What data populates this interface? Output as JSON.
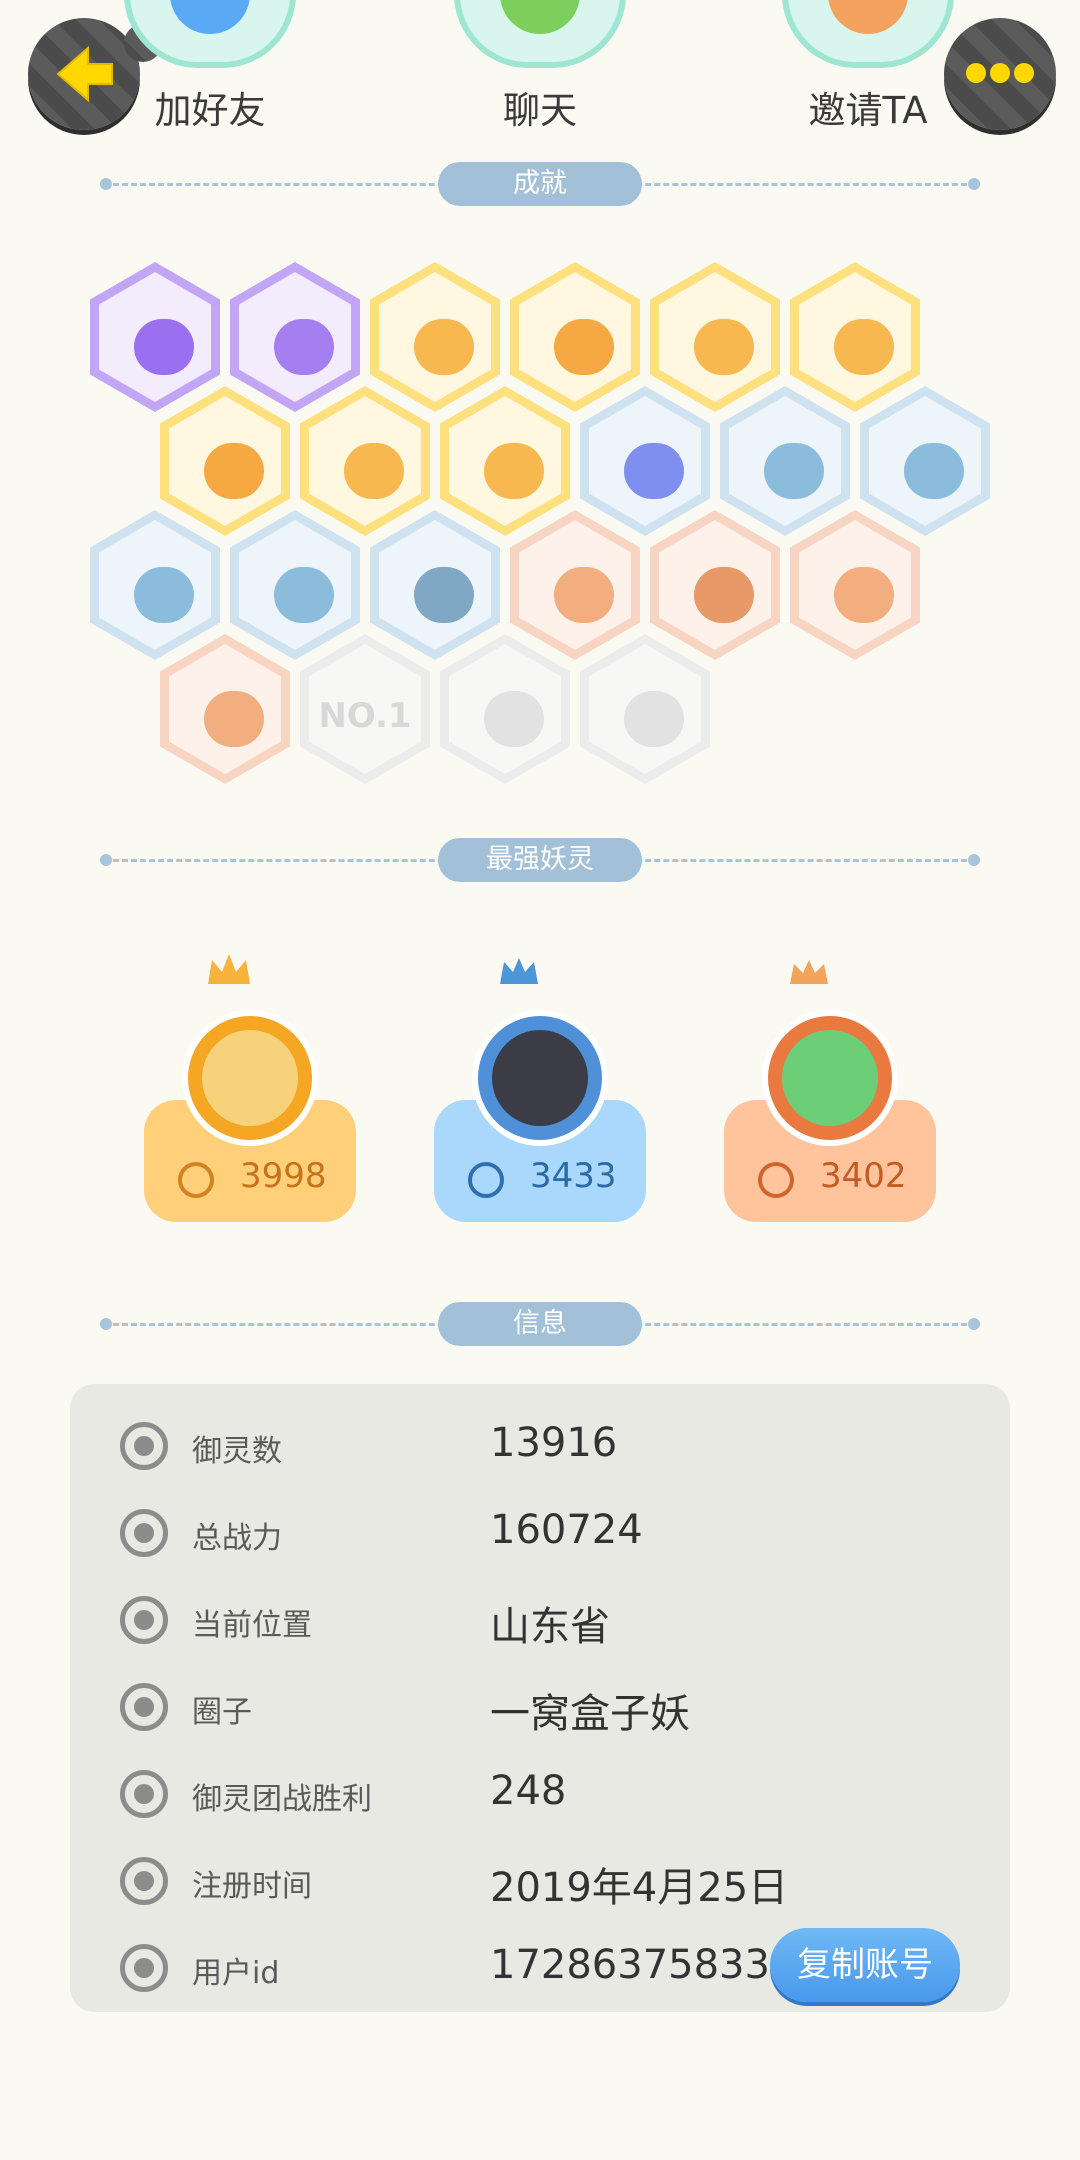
{
  "actions": {
    "add_friend": "加好友",
    "chat": "聊天",
    "invite": "邀请TA"
  },
  "sections": {
    "achievements": "成就",
    "strongest": "最强妖灵",
    "info": "信息"
  },
  "achievements": {
    "locked_badge_text": "NO.1"
  },
  "top_spirits": [
    {
      "power": "3998",
      "theme": "#ffcf7a"
    },
    {
      "power": "3433",
      "theme": "#a9d8fc"
    },
    {
      "power": "3402",
      "theme": "#ffc49c"
    }
  ],
  "info": {
    "rows": [
      {
        "label": "御灵数",
        "value": "13916",
        "icon": "spirit-count-icon"
      },
      {
        "label": "总战力",
        "value": "160724",
        "icon": "power-icon"
      },
      {
        "label": "当前位置",
        "value": "山东省",
        "icon": "location-icon"
      },
      {
        "label": "圈子",
        "value": "一窝盒子妖",
        "icon": "circle-icon"
      },
      {
        "label": "御灵团战胜利",
        "value": "248",
        "icon": "team-battle-icon"
      },
      {
        "label": "注册时间",
        "value": "2019年4月25日",
        "icon": "clock-icon"
      },
      {
        "label": "用户id",
        "value": "17286375833",
        "icon": "id-card-icon"
      }
    ],
    "copy_button": "复制账号"
  },
  "colors": {
    "background": "#fbfaf2",
    "section_pill": "#a2c1d9",
    "accent_blue": "#4898ec",
    "gold": "#ffcf7a",
    "purple": "#b89af2"
  }
}
